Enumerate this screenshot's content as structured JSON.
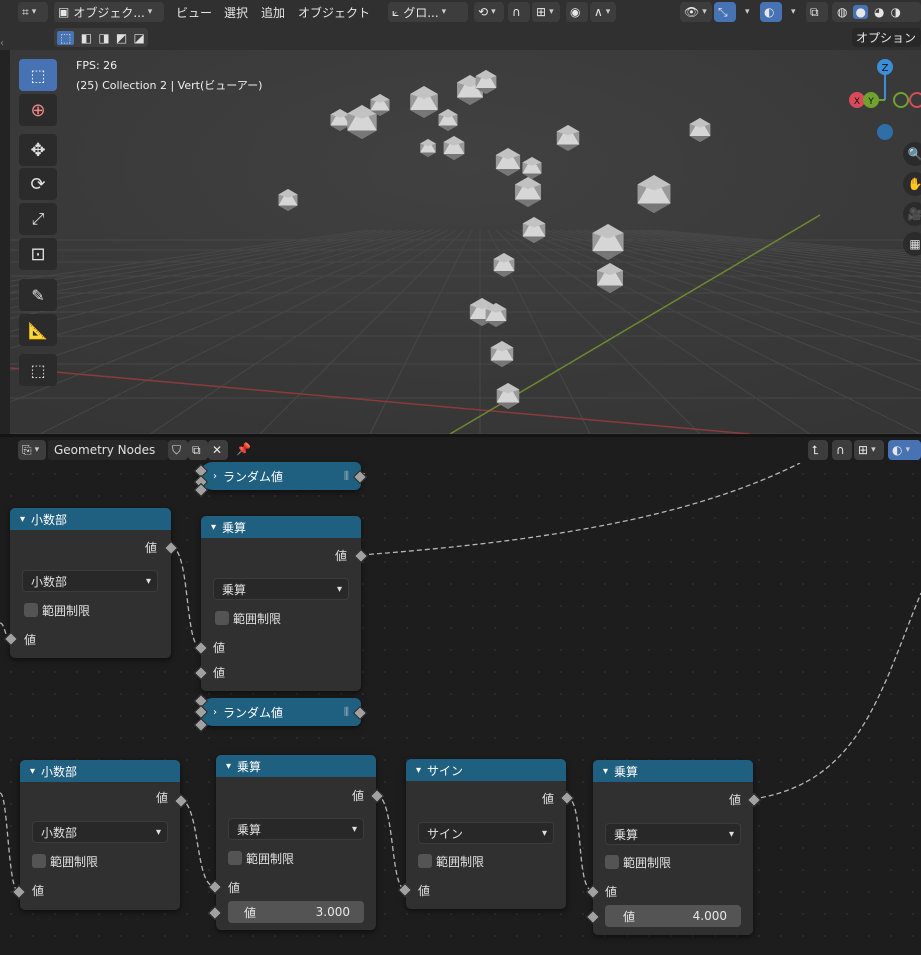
{
  "viewport_header": {
    "mode_label": "オブジェク...",
    "menus": [
      "ビュー",
      "選択",
      "追加",
      "オブジェクト"
    ],
    "transform_label": "グロ..."
  },
  "options_label": "オプション",
  "overlay": {
    "fps": "FPS: 26",
    "collection": "(25) Collection 2 | Vert(ビューアー)"
  },
  "gizmo": {
    "z": "Z",
    "x": "X",
    "y": "Y"
  },
  "node_editor": {
    "tree_name": "Geometry Nodes"
  },
  "nodes": {
    "random_top": {
      "title": "ランダム値"
    },
    "random_bottom": {
      "title": "ランダム値"
    },
    "fract1": {
      "title": "小数部",
      "out_label": "値",
      "op": "小数部",
      "clamp": "範囲制限",
      "in_label": "値"
    },
    "mult1": {
      "title": "乗算",
      "out_label": "値",
      "op": "乗算",
      "clamp": "範囲制限",
      "in1": "値",
      "in2": "値"
    },
    "fract2": {
      "title": "小数部",
      "out_label": "値",
      "op": "小数部",
      "clamp": "範囲制限",
      "in_label": "値"
    },
    "mult2": {
      "title": "乗算",
      "out_label": "値",
      "op": "乗算",
      "clamp": "範囲制限",
      "in1": "値",
      "field_label": "値",
      "field_value": "3.000"
    },
    "sine": {
      "title": "サイン",
      "out_label": "値",
      "op": "サイン",
      "clamp": "範囲制限",
      "in_label": "値"
    },
    "mult3": {
      "title": "乗算",
      "out_label": "値",
      "op": "乗算",
      "clamp": "範囲制限",
      "in1": "値",
      "field_label": "値",
      "field_value": "4.000"
    }
  },
  "colors": {
    "node_header": "#1f5f80",
    "accent": "#4772b3"
  }
}
